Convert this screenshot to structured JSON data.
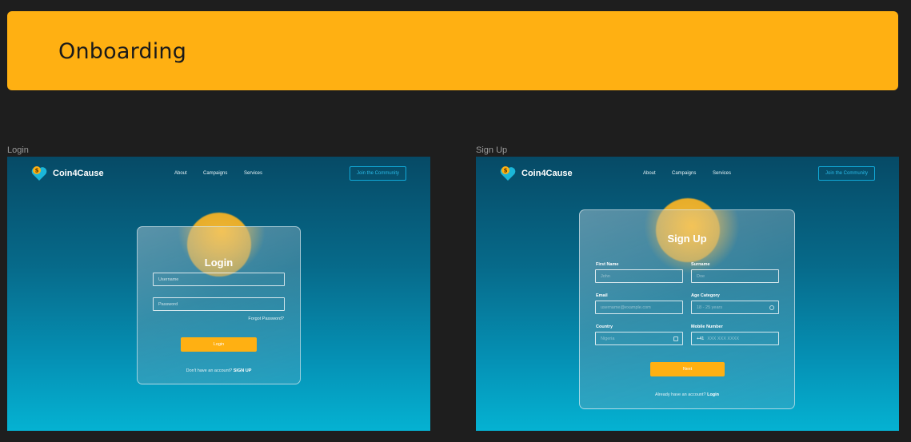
{
  "banner": {
    "title": "Onboarding"
  },
  "frames": {
    "login_label": "Login",
    "signup_label": "Sign Up"
  },
  "nav": {
    "brand": "Coin4Cause",
    "links": [
      "About",
      "Campaigns",
      "Services"
    ],
    "cta": "Join the Community"
  },
  "login": {
    "title": "Login",
    "username_placeholder": "Username",
    "password_placeholder": "Password",
    "forgot": "Forgot Password?",
    "button": "Login",
    "footer_text": "Don't have an account?",
    "footer_link": "SIGN UP"
  },
  "signup": {
    "title": "Sign Up",
    "first_name_label": "First Name",
    "first_name_placeholder": "John",
    "surname_label": "Surname",
    "surname_placeholder": "Doe",
    "email_label": "Email",
    "email_placeholder": "username@example.com",
    "age_label": "Age Category",
    "age_placeholder": "18 - 25 years",
    "country_label": "Country",
    "country_placeholder": "Nigeria",
    "mobile_label": "Mobile Number",
    "mobile_prefix": "+41",
    "mobile_placeholder": "XXX XXX XXXX",
    "button": "Next",
    "footer_text": "Already have an account?",
    "footer_link": "Login"
  },
  "colors": {
    "accent": "#ffb012",
    "link": "#11a9d8",
    "bg": "#1e1e1e"
  }
}
